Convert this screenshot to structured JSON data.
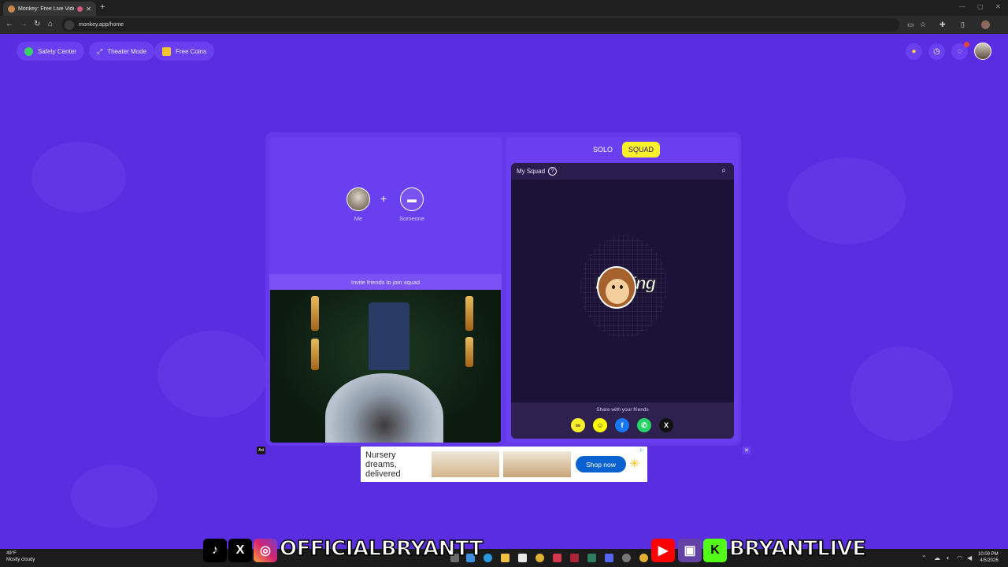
{
  "browser": {
    "tab_title": "Monkey: Free Live Video Ch",
    "url": "monkey.app/home"
  },
  "header": {
    "pills": [
      {
        "label": "Safety Center",
        "icon": "shield-icon"
      },
      {
        "label": "Theater Mode",
        "icon": "expand-icon"
      },
      {
        "label": "Free Coins",
        "icon": "coin-icon"
      }
    ]
  },
  "squad_panel": {
    "me_label": "Me",
    "someone_label": "Someone",
    "invite_text": "Invite friends to join squad"
  },
  "mode_toggle": {
    "solo": "SOLO",
    "squad": "SQUAD",
    "active": "SQUAD"
  },
  "my_squad": {
    "title": "My Squad",
    "empty_text": "Nothing",
    "share_text": "Share with your friends",
    "share_icons": [
      "link-icon",
      "snapchat-icon",
      "facebook-icon",
      "whatsapp-icon",
      "x-icon"
    ]
  },
  "ad": {
    "tag": "Ad",
    "headline": "Nursery dreams, delivered",
    "cta": "Shop now"
  },
  "taskbar": {
    "temp": "49°F",
    "weather": "Mostly cloudy",
    "time": "10:09 PM",
    "date": "4/5/2026"
  },
  "overlay": {
    "handle_left": "OFFICIALBRYANTT",
    "handle_right": "BRYANTLIVE"
  },
  "colors": {
    "background": "#5a2ee0",
    "panel": "#6a3ff0",
    "squad_accent": "#f7f02a",
    "ad_button": "#0a62d0"
  }
}
